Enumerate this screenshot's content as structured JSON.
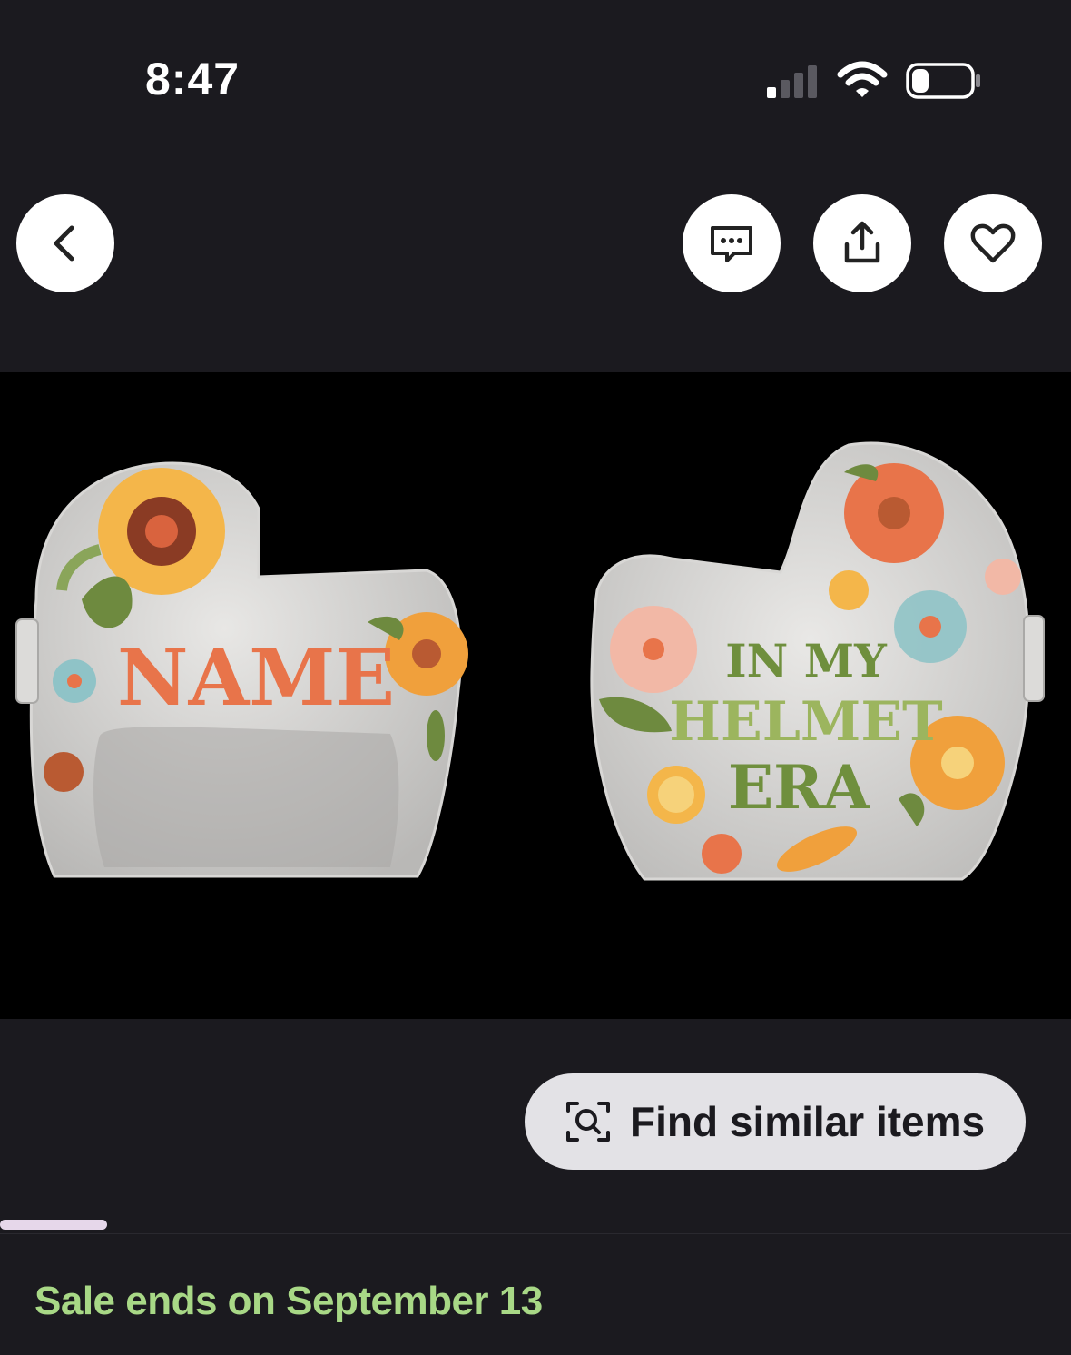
{
  "status_bar": {
    "time": "8:47",
    "signal_icon": "cellular-signal-icon",
    "wifi_icon": "wifi-icon",
    "battery_icon": "battery-icon"
  },
  "top_bar": {
    "back_icon": "chevron-left-icon",
    "message_icon": "message-icon",
    "share_icon": "share-icon",
    "favorite_icon": "heart-icon"
  },
  "product_image": {
    "left_helmet_text": "NAME",
    "right_helmet_text": [
      "IN MY",
      "HELMET",
      "ERA"
    ]
  },
  "find_similar": {
    "label": "Find similar items",
    "icon": "visual-search-icon"
  },
  "sale_text": "Sale ends on September 13",
  "colors": {
    "background": "#1b1a1f",
    "button_bg": "#e3e2e6",
    "sale_green": "#a8d886",
    "helmet_orange": "#e8744a",
    "helmet_green": "#7a9b4e"
  }
}
